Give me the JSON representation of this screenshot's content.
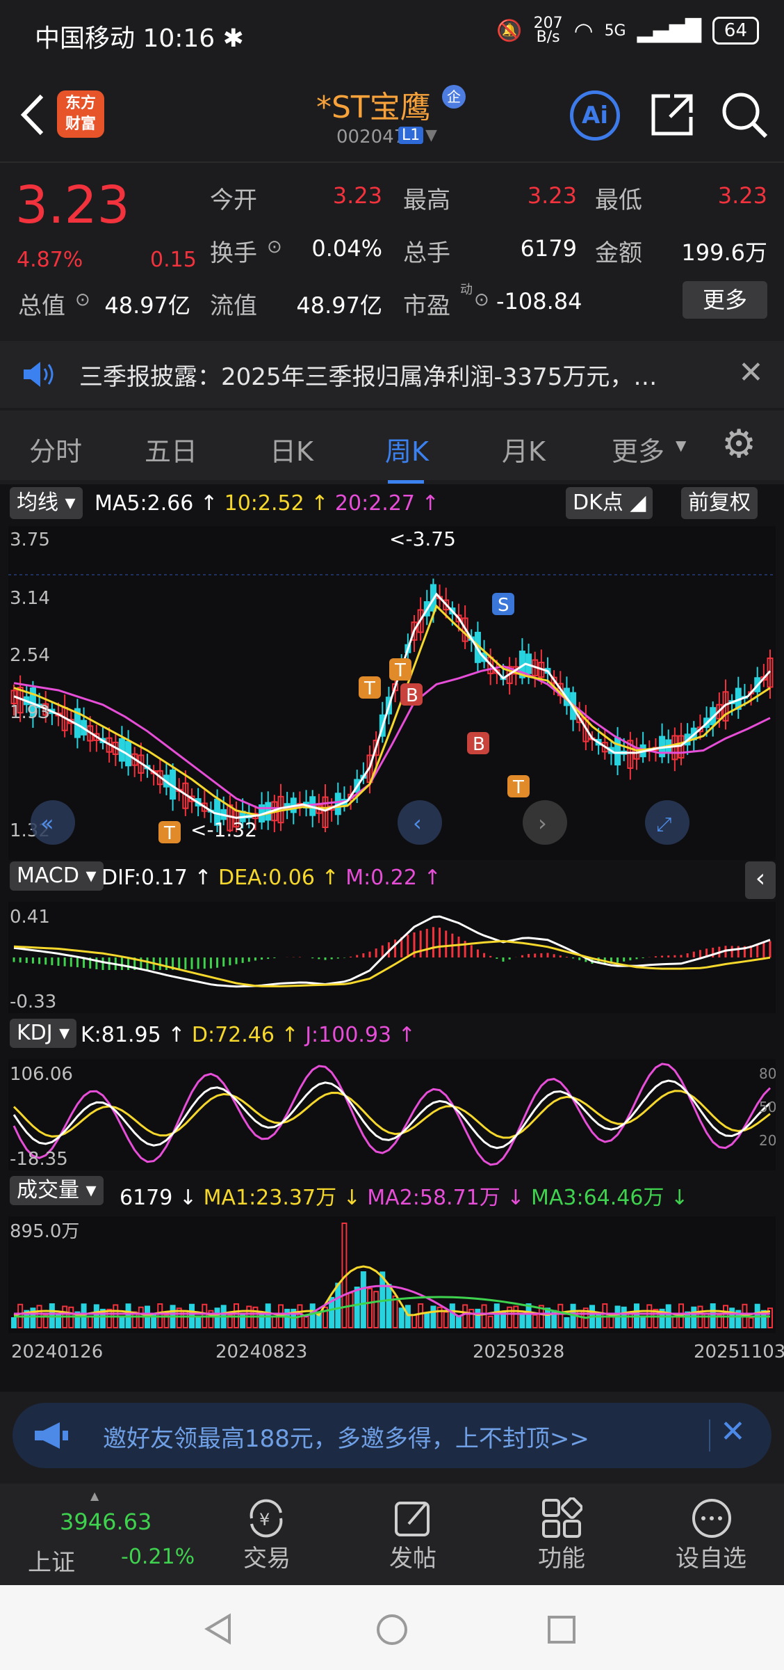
{
  "status": {
    "carrier": "中国移动",
    "time": "10:16",
    "speed_value": "207",
    "speed_unit": "B/s",
    "network": "5G",
    "battery": "64"
  },
  "header": {
    "logo_line1": "东方",
    "logo_line2": "财富",
    "stock_name": "*ST宝鹰",
    "badge": "企",
    "code": "002047",
    "level": "L1",
    "ai_label": "Ai"
  },
  "quote": {
    "price": "3.23",
    "change_pct": "4.87%",
    "change": "0.15",
    "open_label": "今开",
    "open": "3.23",
    "high_label": "最高",
    "high": "3.23",
    "low_label": "最低",
    "low": "3.23",
    "turnover_label": "换手",
    "turnover": "0.04%",
    "volume_label": "总手",
    "volume": "6179",
    "amount_label": "金额",
    "amount": "199.6万",
    "mktcap_label": "总值",
    "mktcap": "48.97亿",
    "float_label": "流值",
    "float": "48.97亿",
    "pe_label": "市盈",
    "pe_sup": "动",
    "pe": "-108.84",
    "more_label": "更多"
  },
  "notice": {
    "text": "三季报披露：2025年三季报归属净利润-3375万元，…"
  },
  "tabs": [
    "分时",
    "五日",
    "日K",
    "周K",
    "月K",
    "更多"
  ],
  "active_tab": "周K",
  "kchart": {
    "ma_selector": "均线",
    "ma5": "MA5:2.66",
    "ma10": "10:2.52",
    "ma20": "20:2.27",
    "dk_button": "DK点",
    "adj_button": "前复权",
    "y_ticks": [
      "3.75",
      "3.14",
      "2.54",
      "1.93",
      "1.32"
    ],
    "max_label": "<-3.75",
    "min_label": "<-1.32",
    "markers": [
      "T",
      "T",
      "B",
      "S",
      "B",
      "T",
      "T"
    ]
  },
  "macd": {
    "selector": "MACD",
    "dif": "DIF:0.17",
    "dea": "DEA:0.06",
    "m": "M:0.22",
    "y_top": "0.41",
    "y_bottom": "-0.33"
  },
  "kdj": {
    "selector": "KDJ",
    "k": "K:81.95",
    "d": "D:72.46",
    "j": "J:100.93",
    "y_top": "106.06",
    "y_bottom": "-18.35",
    "right_ticks": [
      "80",
      "50",
      "20"
    ]
  },
  "volume": {
    "selector": "成交量",
    "value": "6179",
    "ma1": "MA1:23.37万",
    "ma2": "MA2:58.71万",
    "ma3": "MA3:64.46万",
    "y_top": "895.0万"
  },
  "dates": [
    "20240126",
    "20240823",
    "20250328",
    "20251103"
  ],
  "banner": {
    "text": "邀好友领最高188元，多邀多得，上不封顶>>"
  },
  "bottom": {
    "index_value": "3946.63",
    "index_name": "上证",
    "index_change": "-0.21%",
    "trade": "交易",
    "post": "发帖",
    "func": "功能",
    "watch": "设自选"
  },
  "colors": {
    "up": "#f2323c",
    "down": "#27d3de",
    "accent": "#3b82f0",
    "ma5": "#ffffff",
    "ma10": "#f6d82c",
    "ma20": "#e64ed8"
  },
  "chart_data": {
    "type": "candlestick",
    "y_range": [
      1.32,
      3.75
    ],
    "ma5": [
      2.45,
      2.38,
      2.3,
      2.2,
      2.08,
      1.98,
      1.86,
      1.72,
      1.6,
      1.48,
      1.44,
      1.46,
      1.52,
      1.55,
      1.5,
      1.58,
      1.86,
      2.45,
      3.0,
      3.3,
      3.1,
      2.8,
      2.6,
      2.72,
      2.66,
      2.4,
      2.1,
      1.98,
      1.98,
      2.02,
      2.04,
      2.2,
      2.38,
      2.45,
      2.66
    ],
    "ma10": [
      2.52,
      2.46,
      2.38,
      2.3,
      2.2,
      2.1,
      2.0,
      1.88,
      1.76,
      1.62,
      1.5,
      1.46,
      1.5,
      1.53,
      1.52,
      1.54,
      1.72,
      2.2,
      2.7,
      3.2,
      3.02,
      2.85,
      2.68,
      2.62,
      2.58,
      2.4,
      2.2,
      2.06,
      2.0,
      2.02,
      2.06,
      2.12,
      2.3,
      2.4,
      2.52
    ],
    "ma20": [
      2.56,
      2.53,
      2.5,
      2.44,
      2.38,
      2.28,
      2.16,
      2.02,
      1.88,
      1.74,
      1.6,
      1.52,
      1.52,
      1.54,
      1.56,
      1.58,
      1.72,
      2.05,
      2.4,
      2.55,
      2.6,
      2.66,
      2.7,
      2.64,
      2.55,
      2.4,
      2.25,
      2.12,
      2.02,
      1.98,
      1.98,
      2.0,
      2.1,
      2.18,
      2.27
    ]
  }
}
